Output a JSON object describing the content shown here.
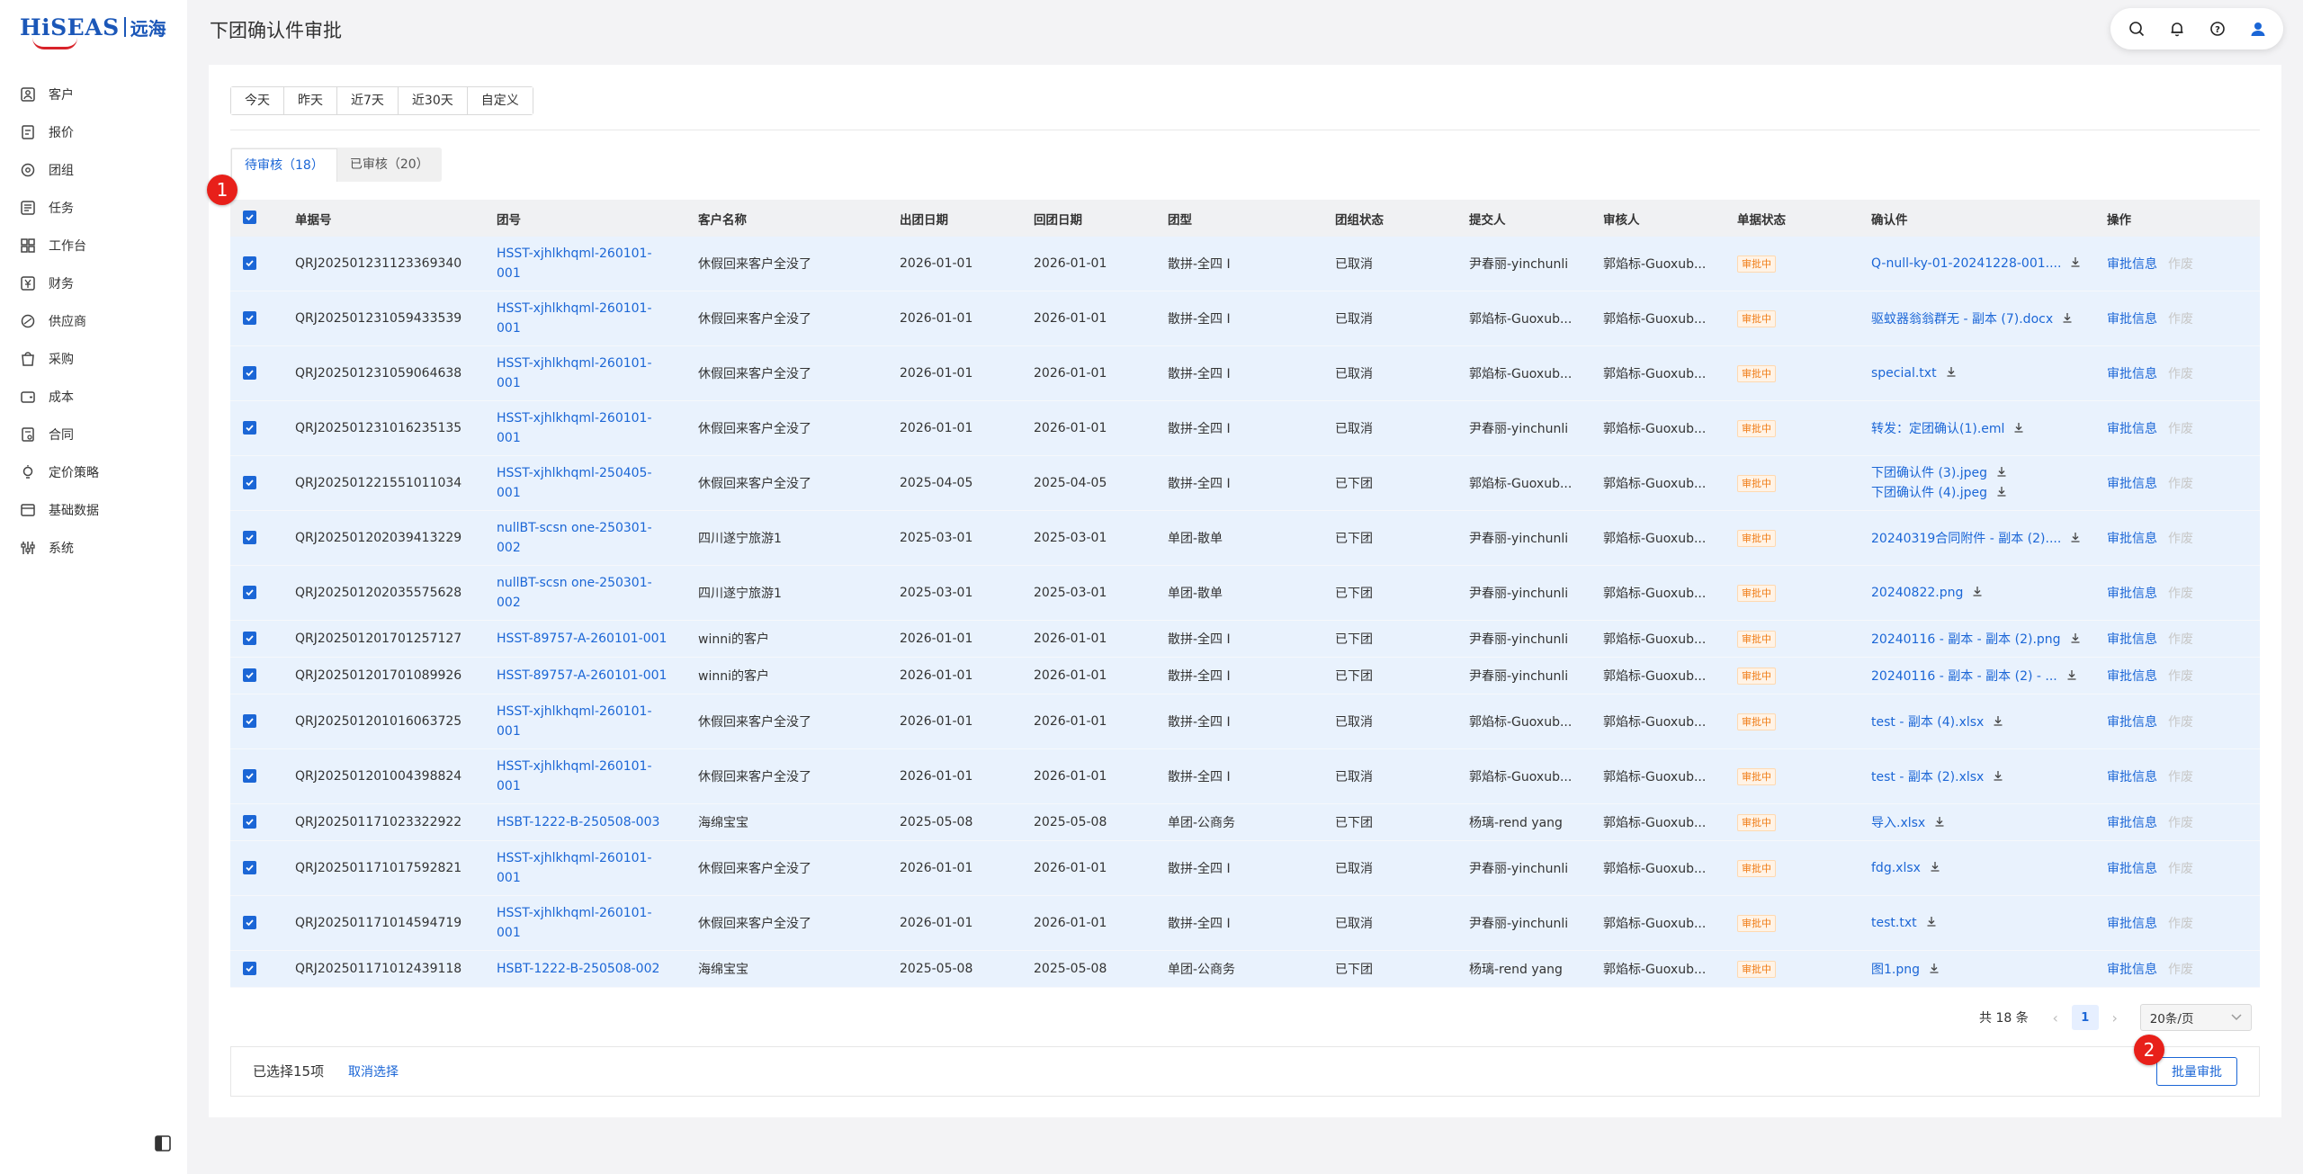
{
  "brand": {
    "name": "HiSEAS",
    "cn": "远海"
  },
  "sidebar": {
    "items": [
      {
        "label": "客户",
        "icon": "customer-icon"
      },
      {
        "label": "报价",
        "icon": "quote-icon"
      },
      {
        "label": "团组",
        "icon": "group-icon"
      },
      {
        "label": "任务",
        "icon": "task-icon"
      },
      {
        "label": "工作台",
        "icon": "workbench-icon"
      },
      {
        "label": "财务",
        "icon": "finance-icon"
      },
      {
        "label": "供应商",
        "icon": "supplier-icon"
      },
      {
        "label": "采购",
        "icon": "purchase-icon"
      },
      {
        "label": "成本",
        "icon": "cost-icon"
      },
      {
        "label": "合同",
        "icon": "contract-icon"
      },
      {
        "label": "定价策略",
        "icon": "pricing-icon"
      },
      {
        "label": "基础数据",
        "icon": "basic-data-icon"
      },
      {
        "label": "系统",
        "icon": "system-icon"
      }
    ]
  },
  "header": {
    "title": "下团确认件审批"
  },
  "filters": {
    "ranges": [
      "今天",
      "昨天",
      "近7天",
      "近30天",
      "自定义"
    ]
  },
  "tabs": [
    {
      "label": "待审核（18）",
      "active": true
    },
    {
      "label": "已审核（20）",
      "active": false
    }
  ],
  "markers": {
    "m1": "1",
    "m2": "2"
  },
  "table": {
    "columns": [
      "单据号",
      "团号",
      "客户名称",
      "出团日期",
      "回团日期",
      "团型",
      "团组状态",
      "提交人",
      "审核人",
      "单据状态",
      "确认件",
      "操作"
    ],
    "status_label": "审批中",
    "op_approve": "审批信息",
    "op_void": "作废",
    "rows": [
      {
        "id": "QRJ202501231123369340",
        "group": [
          "HSST-xjhlkhqml-260101-",
          "001"
        ],
        "customer": "休假回来客户全没了",
        "depart": "2026-01-01",
        "ret": "2026-01-01",
        "type": "散拼-全四 I",
        "gstatus": "已取消",
        "submitter": "尹春丽-yinchunli",
        "auditor": "郭焰标-Guoxub...",
        "files": [
          "Q-null-ky-01-20241228-001...."
        ]
      },
      {
        "id": "QRJ202501231059433539",
        "group": [
          "HSST-xjhlkhqml-260101-",
          "001"
        ],
        "customer": "休假回来客户全没了",
        "depart": "2026-01-01",
        "ret": "2026-01-01",
        "type": "散拼-全四 I",
        "gstatus": "已取消",
        "submitter": "郭焰标-Guoxub...",
        "auditor": "郭焰标-Guoxub...",
        "files": [
          "驱蚊器翁翁群无 - 副本 (7).docx"
        ]
      },
      {
        "id": "QRJ202501231059064638",
        "group": [
          "HSST-xjhlkhqml-260101-",
          "001"
        ],
        "customer": "休假回来客户全没了",
        "depart": "2026-01-01",
        "ret": "2026-01-01",
        "type": "散拼-全四 I",
        "gstatus": "已取消",
        "submitter": "郭焰标-Guoxub...",
        "auditor": "郭焰标-Guoxub...",
        "files": [
          "special.txt"
        ]
      },
      {
        "id": "QRJ202501231016235135",
        "group": [
          "HSST-xjhlkhqml-260101-",
          "001"
        ],
        "customer": "休假回来客户全没了",
        "depart": "2026-01-01",
        "ret": "2026-01-01",
        "type": "散拼-全四 I",
        "gstatus": "已取消",
        "submitter": "尹春丽-yinchunli",
        "auditor": "郭焰标-Guoxub...",
        "files": [
          "转发：定团确认(1).eml"
        ]
      },
      {
        "id": "QRJ202501221551011034",
        "group": [
          "HSST-xjhlkhqml-250405-",
          "001"
        ],
        "customer": "休假回来客户全没了",
        "depart": "2025-04-05",
        "ret": "2025-04-05",
        "type": "散拼-全四 I",
        "gstatus": "已下团",
        "submitter": "郭焰标-Guoxub...",
        "auditor": "郭焰标-Guoxub...",
        "files": [
          "下团确认件 (3).jpeg",
          "下团确认件 (4).jpeg"
        ]
      },
      {
        "id": "QRJ202501202039413229",
        "group": [
          "nullBT-scsn one-250301-",
          "002"
        ],
        "customer": "四川遂宁旅游1",
        "depart": "2025-03-01",
        "ret": "2025-03-01",
        "type": "单团-散单",
        "gstatus": "已下团",
        "submitter": "尹春丽-yinchunli",
        "auditor": "郭焰标-Guoxub...",
        "files": [
          "20240319合同附件 - 副本 (2)...."
        ]
      },
      {
        "id": "QRJ202501202035575628",
        "group": [
          "nullBT-scsn one-250301-",
          "002"
        ],
        "customer": "四川遂宁旅游1",
        "depart": "2025-03-01",
        "ret": "2025-03-01",
        "type": "单团-散单",
        "gstatus": "已下团",
        "submitter": "尹春丽-yinchunli",
        "auditor": "郭焰标-Guoxub...",
        "files": [
          "20240822.png"
        ]
      },
      {
        "id": "QRJ202501201701257127",
        "group": [
          "HSST-89757-A-260101-001"
        ],
        "customer": "winni的客户",
        "depart": "2026-01-01",
        "ret": "2026-01-01",
        "type": "散拼-全四 I",
        "gstatus": "已下团",
        "submitter": "尹春丽-yinchunli",
        "auditor": "郭焰标-Guoxub...",
        "files": [
          "20240116 - 副本 - 副本 (2).png"
        ]
      },
      {
        "id": "QRJ202501201701089926",
        "group": [
          "HSST-89757-A-260101-001"
        ],
        "customer": "winni的客户",
        "depart": "2026-01-01",
        "ret": "2026-01-01",
        "type": "散拼-全四 I",
        "gstatus": "已下团",
        "submitter": "尹春丽-yinchunli",
        "auditor": "郭焰标-Guoxub...",
        "files": [
          "20240116 - 副本 - 副本 (2) - ..."
        ]
      },
      {
        "id": "QRJ202501201016063725",
        "group": [
          "HSST-xjhlkhqml-260101-",
          "001"
        ],
        "customer": "休假回来客户全没了",
        "depart": "2026-01-01",
        "ret": "2026-01-01",
        "type": "散拼-全四 I",
        "gstatus": "已取消",
        "submitter": "郭焰标-Guoxub...",
        "auditor": "郭焰标-Guoxub...",
        "files": [
          "test - 副本 (4).xlsx"
        ]
      },
      {
        "id": "QRJ202501201004398824",
        "group": [
          "HSST-xjhlkhqml-260101-",
          "001"
        ],
        "customer": "休假回来客户全没了",
        "depart": "2026-01-01",
        "ret": "2026-01-01",
        "type": "散拼-全四 I",
        "gstatus": "已取消",
        "submitter": "郭焰标-Guoxub...",
        "auditor": "郭焰标-Guoxub...",
        "files": [
          "test - 副本 (2).xlsx"
        ]
      },
      {
        "id": "QRJ202501171023322922",
        "group": [
          "HSBT-1222-B-250508-003"
        ],
        "customer": "海绵宝宝",
        "depart": "2025-05-08",
        "ret": "2025-05-08",
        "type": "单团-公商务",
        "gstatus": "已下团",
        "submitter": "杨璃-rend yang",
        "auditor": "郭焰标-Guoxub...",
        "files": [
          "导入.xlsx"
        ]
      },
      {
        "id": "QRJ202501171017592821",
        "group": [
          "HSST-xjhlkhqml-260101-",
          "001"
        ],
        "customer": "休假回来客户全没了",
        "depart": "2026-01-01",
        "ret": "2026-01-01",
        "type": "散拼-全四 I",
        "gstatus": "已取消",
        "submitter": "尹春丽-yinchunli",
        "auditor": "郭焰标-Guoxub...",
        "files": [
          "fdg.xlsx"
        ]
      },
      {
        "id": "QRJ202501171014594719",
        "group": [
          "HSST-xjhlkhqml-260101-",
          "001"
        ],
        "customer": "休假回来客户全没了",
        "depart": "2026-01-01",
        "ret": "2026-01-01",
        "type": "散拼-全四 I",
        "gstatus": "已取消",
        "submitter": "尹春丽-yinchunli",
        "auditor": "郭焰标-Guoxub...",
        "files": [
          "test.txt"
        ]
      },
      {
        "id": "QRJ202501171012439118",
        "group": [
          "HSBT-1222-B-250508-002"
        ],
        "customer": "海绵宝宝",
        "depart": "2025-05-08",
        "ret": "2025-05-08",
        "type": "单团-公商务",
        "gstatus": "已下团",
        "submitter": "杨璃-rend yang",
        "auditor": "郭焰标-Guoxub...",
        "files": [
          "图1.png"
        ]
      }
    ]
  },
  "pagination": {
    "total": "共 18 条",
    "page": "1",
    "page_size": "20条/页"
  },
  "bottom_bar": {
    "selected": "已选择15项",
    "cancel": "取消选择",
    "batch": "批量审批"
  },
  "colors": {
    "primary": "#1b66d6",
    "row_selected": "#e9f2fd",
    "status_orange": "#f07c16",
    "marker_red": "#e8201a"
  }
}
